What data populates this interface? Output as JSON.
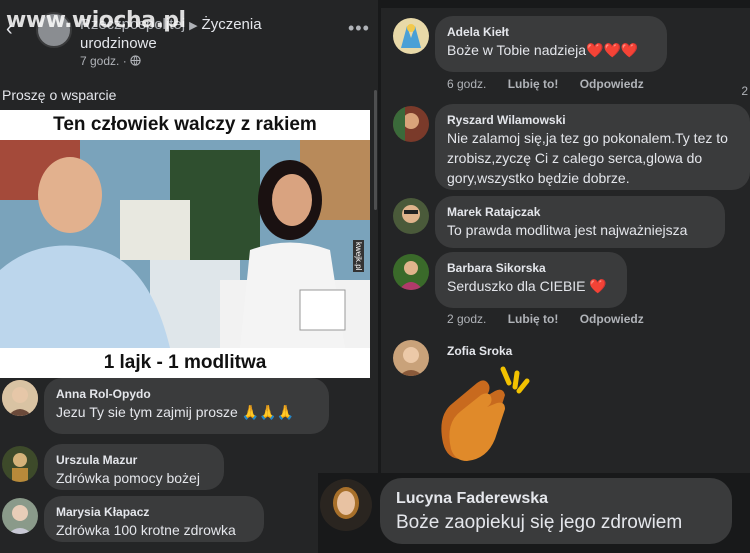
{
  "watermark": "www.wiocha.pl",
  "header": {
    "back_icon": "chevron-left",
    "group_name": "Rzeczpospolitej",
    "separator": "▶",
    "post_title": "Życzenia urodzinowe",
    "time": "7 godz. ·",
    "privacy_icon": "globe",
    "more_icon": "more-dots"
  },
  "post": {
    "text": "Proszę o wsparcie",
    "meme_top": "Ten człowiek walczy z rakiem",
    "meme_bottom": "1 lajk - 1 modlitwa",
    "meme_tag": "kwejk.pl"
  },
  "left_comments": [
    {
      "name": "Anna Rol-Opydo",
      "text": "Jezu Ty sie tym zajmij prosze 🙏🙏🙏"
    },
    {
      "name": "Urszula Mazur",
      "text": "Zdrówka pomocy bożej"
    },
    {
      "name": "Marysia Kłapacz",
      "text": "Zdrówka 100 krotne zdrowka"
    }
  ],
  "right_comments": [
    {
      "name": "Adela Kiełt",
      "text": "Boże w Tobie nadzieja❤️❤️❤️",
      "time": "6 godz.",
      "like": "Lubię to!",
      "reply": "Odpowiedz"
    },
    {
      "name": "Ryszard Wilamowski",
      "text": "Nie zalamoj się,ja tez go pokonalem.Ty tez to zrobisz,zyczę Ci z calego serca,glowa do gory,wszystko będzie dobrze."
    },
    {
      "name": "Marek Ratajczak",
      "text": "To prawda modlitwa jest najważniejsza"
    },
    {
      "name": "Barbara Sikorska",
      "text": "Serduszko dla CIEBIE ❤️",
      "time": "2 godz.",
      "like": "Lubię to!",
      "reply": "Odpowiedz"
    },
    {
      "name": "Zofia Sroka",
      "sticker": "clapping-hands"
    }
  ],
  "reaction_count": "2",
  "bottom_comment": {
    "name": "Lucyna Faderewska",
    "text": "Boże zaopiekuj się jego zdrowiem"
  },
  "colors": {
    "background": "#18191a",
    "panel": "#242526",
    "bubble": "#3a3b3c",
    "text": "#e4e6eb",
    "muted": "#b0b3b8"
  }
}
